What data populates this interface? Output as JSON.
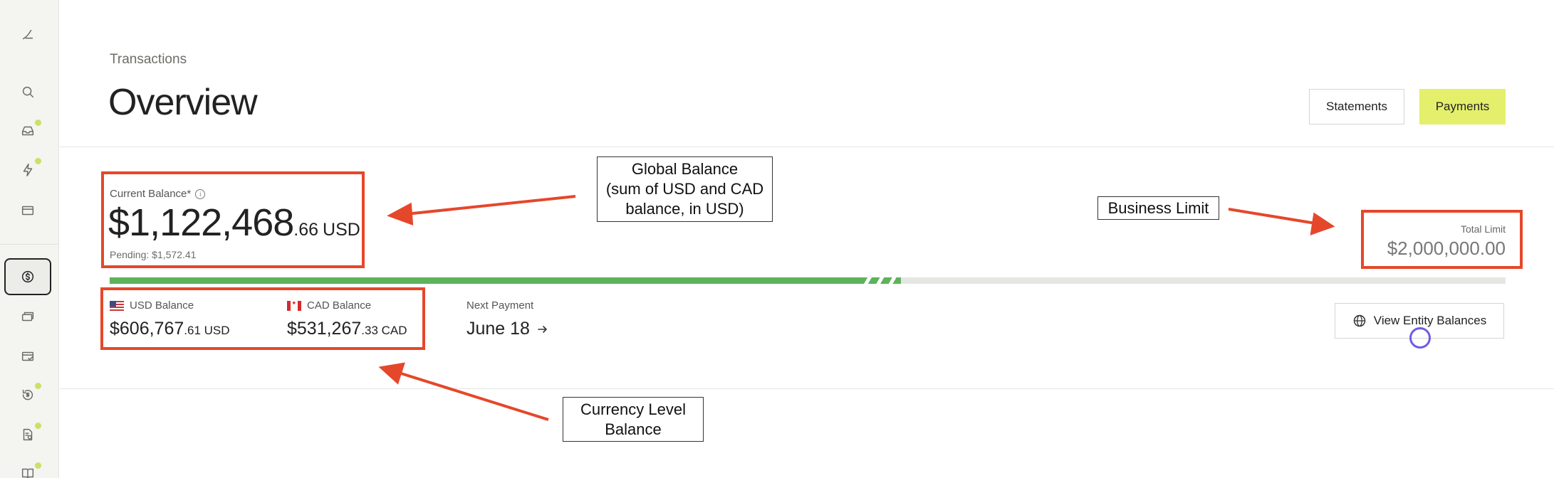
{
  "breadcrumb": "Transactions",
  "page_title": "Overview",
  "header_buttons": {
    "statements": "Statements",
    "payments": "Payments"
  },
  "balance": {
    "label": "Current Balance*",
    "info_icon": "info-icon",
    "amount_main": "$1,122,468",
    "amount_cents": ".66",
    "currency": "USD",
    "pending": "Pending: $1,572.41"
  },
  "limit": {
    "label": "Total Limit",
    "value": "$2,000,000.00"
  },
  "progress": {
    "used_fraction": 0.537,
    "pending_fraction": 0.03
  },
  "sub_balances": [
    {
      "flag": "us-flag",
      "label": "USD Balance",
      "main": "$606,767",
      "small": ".61 USD"
    },
    {
      "flag": "ca-flag",
      "label": "CAD Balance",
      "main": "$531,267",
      "small": ".33 CAD"
    }
  ],
  "next_payment": {
    "label": "Next Payment",
    "value": "June 18",
    "icon": "arrow-right-icon"
  },
  "entity_button": {
    "label": "View Entity Balances",
    "icon": "globe-icon"
  },
  "annotations": {
    "global_balance": "Global Balance\n(sum of USD and CAD\nbalance, in USD)",
    "business_limit": "Business Limit",
    "currency_level": "Currency Level\nBalance"
  },
  "colors": {
    "accent": "#e4ef6c",
    "progress": "#5db25a",
    "annotation": "#e5472b"
  }
}
